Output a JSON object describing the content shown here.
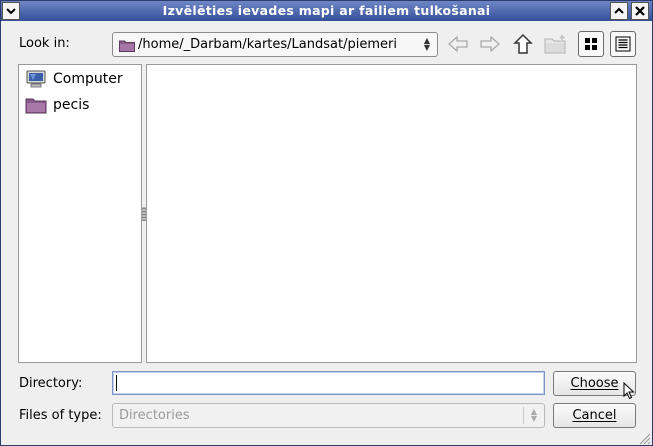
{
  "window": {
    "title": "Izvēlēties ievades mapi ar failiem tulkošanai"
  },
  "lookin": {
    "label": "Look in:",
    "path": "/home/_Darbam/kartes/Landsat/piemeri"
  },
  "toolbar": {
    "back_icon": "arrow-left-icon",
    "forward_icon": "arrow-right-icon",
    "up_icon": "arrow-up-icon",
    "new_folder_icon": "new-folder-icon",
    "icon_view_icon": "grid-view-icon",
    "list_view_icon": "list-view-icon"
  },
  "places": {
    "items": [
      {
        "label": "Computer",
        "icon": "computer-icon"
      },
      {
        "label": "pecis",
        "icon": "folder-icon"
      }
    ]
  },
  "directory": {
    "label": "Directory:",
    "value": "",
    "choose_label": "Choose"
  },
  "filetype": {
    "label": "Files of type:",
    "selected": "Directories",
    "cancel_label": "Cancel"
  },
  "colors": {
    "titlebar": "#34509b",
    "folder": "#8a5a8a",
    "focus_border": "#7b93c9"
  }
}
